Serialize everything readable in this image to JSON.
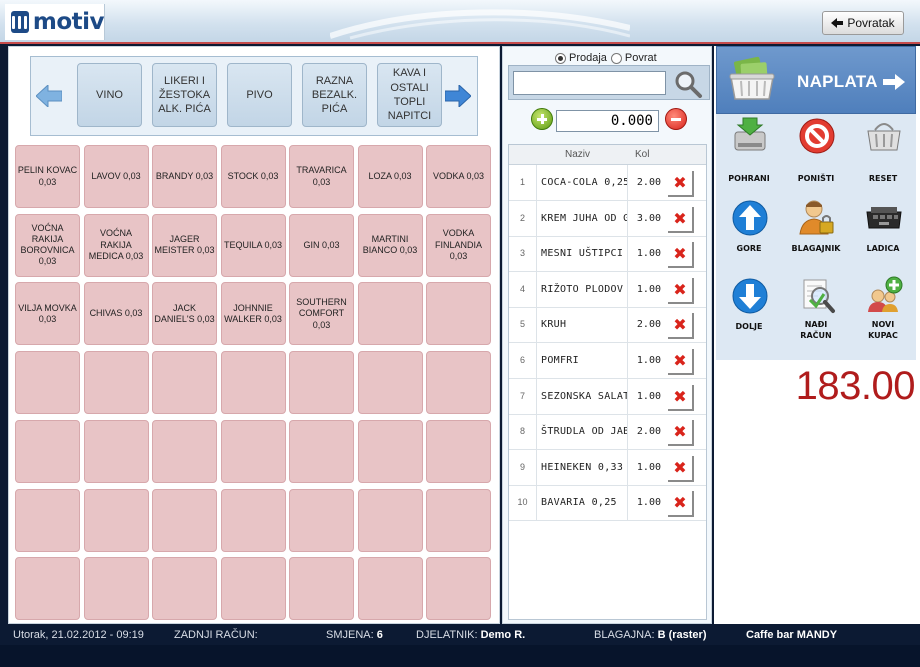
{
  "header": {
    "logo_text": "motiv",
    "back_label": "Povratak"
  },
  "categories": {
    "items": [
      "VINO",
      "LIKERI I ŽESTOKA ALK. PIĆA",
      "PIVO",
      "RAZNA BEZALK. PIĆA",
      "KAVA I OSTALI TOPLI NAPITCI"
    ]
  },
  "products": [
    [
      "PELIN KOVAC 0,03",
      "LAVOV 0,03",
      "BRANDY 0,03",
      "STOCK 0,03",
      "TRAVARICA 0,03",
      "LOZA 0,03",
      "VODKA 0,03"
    ],
    [
      "VOĆNA RAKIJA BOROVNICA 0,03",
      "VOĆNA RAKIJA MEDICA 0,03",
      "JAGER MEISTER 0,03",
      "TEQUILA 0,03",
      "GIN 0,03",
      "MARTINI BIANCO 0,03",
      "VODKA FINLANDIA 0,03"
    ],
    [
      "VILJA MOVKA 0,03",
      "CHIVAS 0,03",
      "JACK DANIEL'S 0,03",
      "JOHNNIE WALKER 0,03",
      "SOUTHERN COMFORT 0,03",
      "",
      ""
    ],
    [
      "",
      "",
      "",
      "",
      "",
      "",
      ""
    ],
    [
      "",
      "",
      "",
      "",
      "",
      "",
      ""
    ],
    [
      "",
      "",
      "",
      "",
      "",
      "",
      ""
    ],
    [
      "",
      "",
      "",
      "",
      "",
      "",
      ""
    ]
  ],
  "order_panel": {
    "mode_sale": "Prodaja",
    "mode_return": "Povrat",
    "search_value": "",
    "quantity": "0.000",
    "col_name": "Naziv",
    "col_qty": "Kol",
    "items": [
      {
        "num": "1",
        "name": "COCA-COLA 0,25",
        "qty": "2.00"
      },
      {
        "num": "2",
        "name": "KREM JUHA OD G",
        "qty": "3.00"
      },
      {
        "num": "3",
        "name": "MESNI UŠTIPCI",
        "qty": "1.00"
      },
      {
        "num": "4",
        "name": "RIŽOTO PLODOV",
        "qty": "1.00"
      },
      {
        "num": "5",
        "name": "KRUH",
        "qty": "2.00"
      },
      {
        "num": "6",
        "name": "POMFRI",
        "qty": "1.00"
      },
      {
        "num": "7",
        "name": "SEZONSKA SALAT",
        "qty": "1.00"
      },
      {
        "num": "8",
        "name": "ŠTRUDLA OD JAB",
        "qty": "2.00"
      },
      {
        "num": "9",
        "name": "HEINEKEN 0,33",
        "qty": "1.00"
      },
      {
        "num": "10",
        "name": "BAVARIA 0,25",
        "qty": "1.00"
      }
    ],
    "delete_glyph": "✖"
  },
  "actions": {
    "naplata": "NAPLATA",
    "pohrani": "POHRANI",
    "ponisti": "PONIŠTI",
    "reset": "RESET",
    "gore": "GORE",
    "blagajnik": "BLAGAJNIK",
    "ladica": "LADICA",
    "dolje": "DOLJE",
    "nadi_racun_1": "NAĐI",
    "nadi_racun_2": "RAČUN",
    "novi_kupac_1": "NOVI",
    "novi_kupac_2": "KUPAC"
  },
  "total": "183.00",
  "status": {
    "datetime": "Utorak, 21.02.2012 - 09:19",
    "last_receipt_label": "ZADNJI RAČUN:",
    "shift_label": "SMJENA:",
    "shift_value": "6",
    "employee_label": "DJELATNIK:",
    "employee_value": "Demo R.",
    "register_label": "BLAGAJNA:",
    "register_value": "B (raster)",
    "venue": "Caffe bar MANDY"
  },
  "colors": {
    "product_button": "#e8c4c6",
    "category_button": "#c2d5e6",
    "total_text": "#b01c1c",
    "naplata_bg": "#5a88c3"
  }
}
